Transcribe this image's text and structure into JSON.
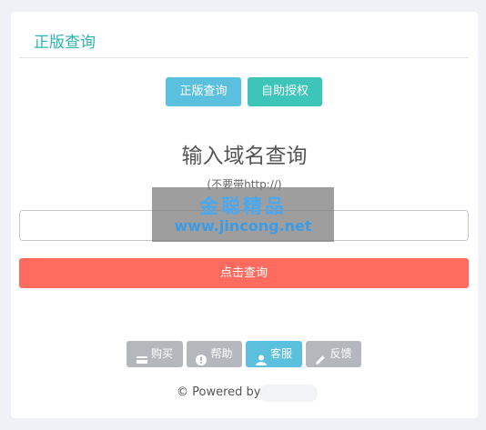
{
  "panel": {
    "title": "正版查询"
  },
  "tabs": {
    "genuine_label": "正版查询",
    "auth_label": "自助授权"
  },
  "form": {
    "heading": "输入域名查询",
    "hint": "(不要带http://)",
    "input_value": "",
    "submit_label": "点击查询"
  },
  "watermark": {
    "line1": "金聪精品",
    "line2": "www.jincong.net"
  },
  "footer": {
    "buttons": [
      {
        "label": "购买",
        "icon": "card-icon"
      },
      {
        "label": "帮助",
        "icon": "exclamation-icon"
      },
      {
        "label": "客服",
        "icon": "user-icon"
      },
      {
        "label": "反馈",
        "icon": "pencil-icon"
      }
    ],
    "powered_text": "© Powered by"
  },
  "colors": {
    "accent_teal": "#2cb4b0",
    "info_blue": "#5bc0de",
    "success_teal": "#3ec5b9",
    "danger_red": "#ff6b5e",
    "muted_gray": "#b4b8bd"
  }
}
